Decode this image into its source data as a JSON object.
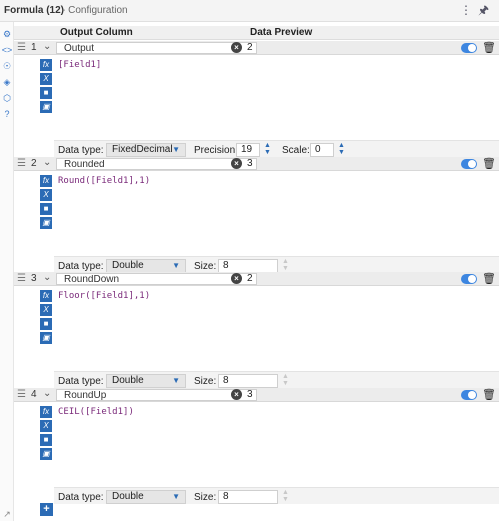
{
  "window": {
    "title": "Formula (12)",
    "subtitle": "- Configuration",
    "menu_icon": "vertical-dots-icon",
    "pin_icon": "pin-icon"
  },
  "left_rail": [
    "gear-icon",
    "code-icon",
    "target-icon",
    "tag-icon",
    "cube-icon",
    "help-icon"
  ],
  "table_header": {
    "output_column": "Output Column",
    "data_preview": "Data Preview"
  },
  "rows": [
    {
      "index": "1",
      "name": "Output",
      "preview": "2",
      "expression": "[Field1]",
      "data_type_label": "Data type:",
      "data_type": "FixedDecimal",
      "precision_label": "Precision:",
      "precision": "19",
      "scale_label": "Scale:",
      "scale": "0"
    },
    {
      "index": "2",
      "name": "Rounded",
      "preview": "3",
      "expression": "Round([Field1],1)",
      "data_type_label": "Data type:",
      "data_type": "Double",
      "size_label": "Size:",
      "size": "8"
    },
    {
      "index": "3",
      "name": "RoundDown",
      "preview": "2",
      "expression": "Floor([Field1],1)",
      "data_type_label": "Data type:",
      "data_type": "Double",
      "size_label": "Size:",
      "size": "8"
    },
    {
      "index": "4",
      "name": "RoundUp",
      "preview": "3",
      "expression": "CEIL([Field1])",
      "data_type_label": "Data type:",
      "data_type": "Double",
      "size_label": "Size:",
      "size": "8"
    }
  ],
  "add_button": "+",
  "colors": {
    "accent": "#2b6bb5",
    "toggle_on": "#3d86e0",
    "expression_text": "#7a2a7a"
  }
}
